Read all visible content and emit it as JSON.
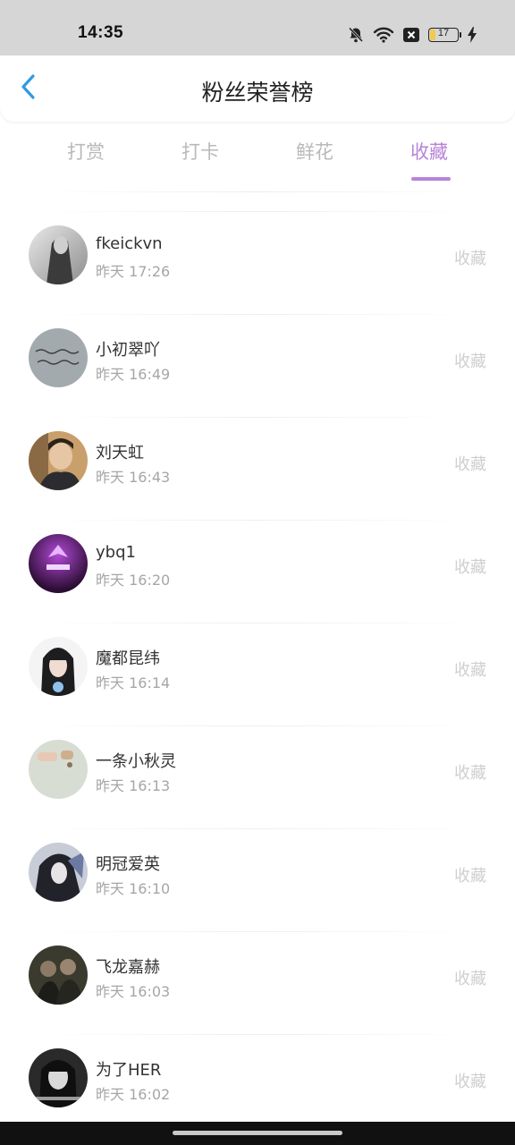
{
  "status_bar": {
    "time": "14:35",
    "battery_level": "17",
    "icons": [
      "bell-off-icon",
      "wifi-icon",
      "sim-off-icon",
      "battery-icon",
      "charging-icon"
    ]
  },
  "header": {
    "title": "粉丝荣誉榜",
    "back_icon": "chevron-left-icon"
  },
  "tabs": [
    {
      "label": "打赏",
      "active": false
    },
    {
      "label": "打卡",
      "active": false
    },
    {
      "label": "鲜花",
      "active": false
    },
    {
      "label": "收藏",
      "active": true
    }
  ],
  "colors": {
    "accent": "#b883d8",
    "back_icon": "#2f9be0",
    "inactive_tab": "#b9b9b9",
    "secondary_text": "#a6a6a6"
  },
  "list": [
    {
      "name": "fkeickvn",
      "time": "昨天 17:26",
      "action": "收藏"
    },
    {
      "name": "小初翠吖",
      "time": "昨天 16:49",
      "action": "收藏"
    },
    {
      "name": "刘天虹",
      "time": "昨天 16:43",
      "action": "收藏"
    },
    {
      "name": "ybq1",
      "time": "昨天 16:20",
      "action": "收藏"
    },
    {
      "name": "魔都昆纬",
      "time": "昨天 16:14",
      "action": "收藏"
    },
    {
      "name": "一条小秋灵",
      "time": "昨天 16:13",
      "action": "收藏"
    },
    {
      "name": "明冠爱英",
      "time": "昨天 16:10",
      "action": "收藏"
    },
    {
      "name": "飞龙嘉赫",
      "time": "昨天 16:03",
      "action": "收藏"
    },
    {
      "name": "为了HER",
      "time": "昨天 16:02",
      "action": "收藏"
    }
  ]
}
